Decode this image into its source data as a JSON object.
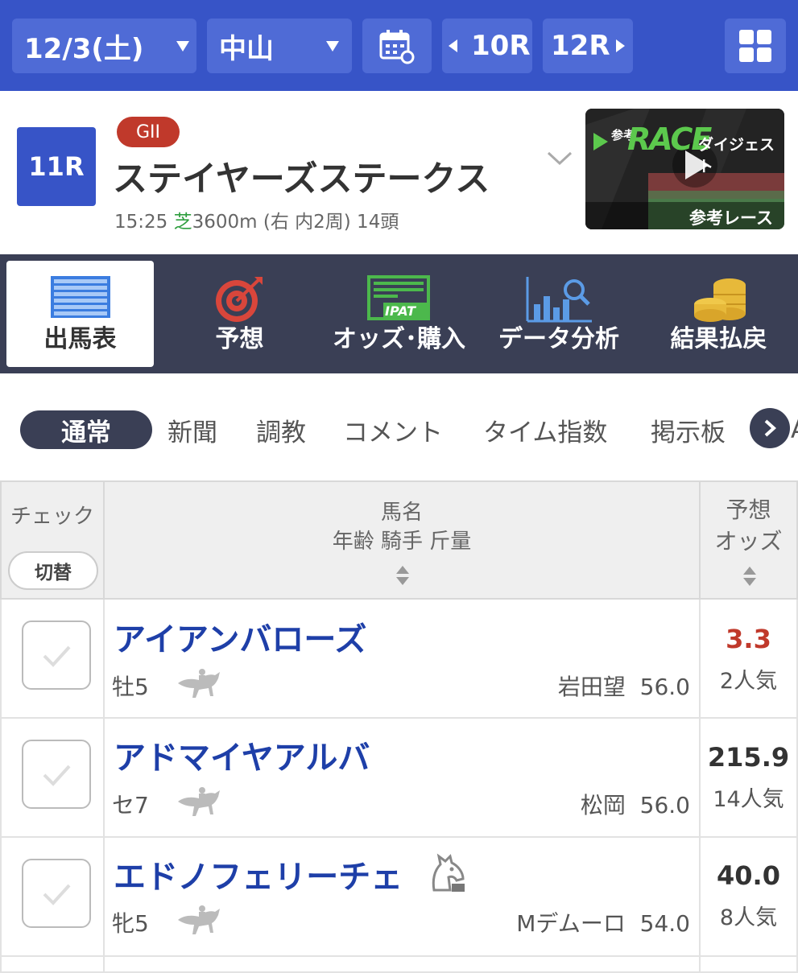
{
  "topbar": {
    "date": "12/3(土)",
    "venue": "中山",
    "prev_race": "10R",
    "next_race": "12R"
  },
  "race": {
    "number": "11R",
    "grade": "GII",
    "name": "ステイヤーズステークス",
    "time": "15:25",
    "surface": "芝",
    "details": "3600m (右 内2周) 14頭",
    "thumb_title_a": "参考",
    "thumb_title_b": "RACE",
    "thumb_title_c": "ダイジェスト",
    "thumb_label": "参考レース"
  },
  "nav": [
    {
      "label": "出馬表"
    },
    {
      "label": "予想"
    },
    {
      "label": "オッズ･購入"
    },
    {
      "label": "データ分析"
    },
    {
      "label": "結果払戻"
    }
  ],
  "nav_ipat": "IPAT",
  "subtabs": [
    "通常",
    "新聞",
    "調教",
    "コメント",
    "タイム指数",
    "掲示板"
  ],
  "subtab_cut": "A",
  "table": {
    "col_check": "チェック",
    "toggle": "切替",
    "col_name_1": "馬名",
    "col_name_2": "年齢 騎手 斤量",
    "col_odds_1": "予想",
    "col_odds_2": "オッズ"
  },
  "horses": [
    {
      "name": "アイアンバローズ",
      "sexage": "牡5",
      "jockey": "岩田望",
      "weight": "56.0",
      "odds": "3.3",
      "popularity": "2人気"
    },
    {
      "name": "アドマイヤアルバ",
      "sexage": "セ7",
      "jockey": "松岡",
      "weight": "56.0",
      "odds": "215.9",
      "popularity": "14人気"
    },
    {
      "name": "エドノフェリーチェ",
      "sexage": "牝5",
      "jockey": "Mデムーロ",
      "weight": "54.0",
      "odds": "40.0",
      "popularity": "8人気"
    }
  ],
  "colors": {
    "primary": "#3754c7",
    "nav_bg": "#3a3f55",
    "horse_name": "#1e3fa8",
    "favorite_odds": "#c0392b",
    "grade_badge": "#c0392b",
    "turf": "#2e9e3e"
  }
}
